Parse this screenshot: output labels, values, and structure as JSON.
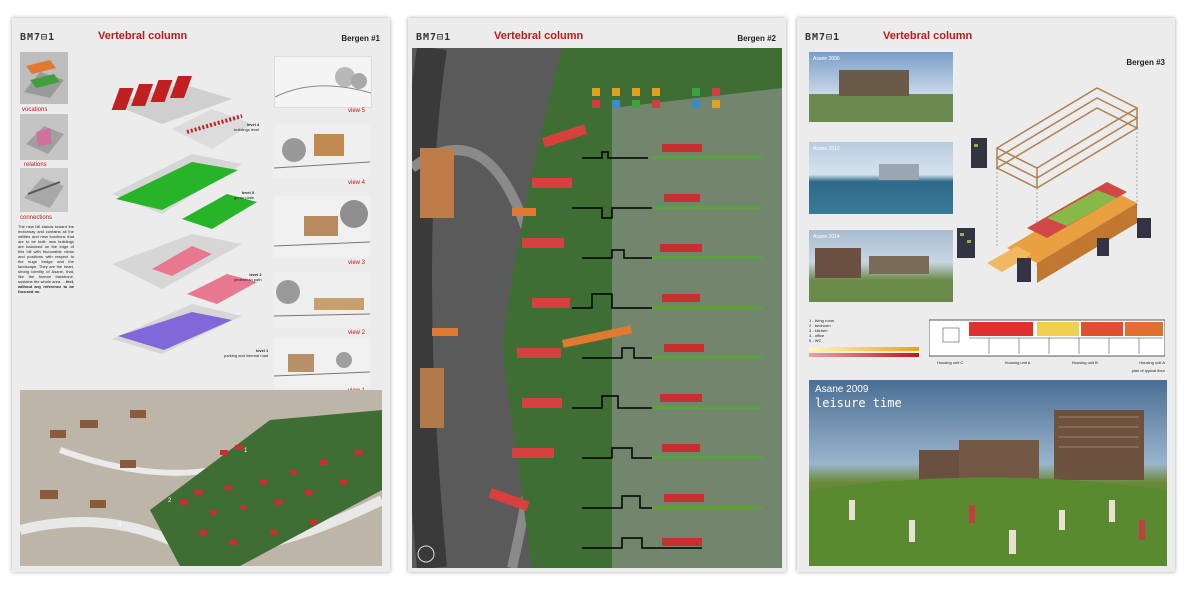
{
  "panels": [
    {
      "logo": "BM7⊟1",
      "title": "Vertebral column",
      "sheet": "Bergen #1",
      "sidebar_labels": [
        "vocations",
        "relations",
        "connections"
      ],
      "levels": [
        {
          "name": "level 4",
          "desc": "buildings level"
        },
        {
          "name": "level 3",
          "desc": "green plate"
        },
        {
          "name": "level 2",
          "desc": "pedestrian path"
        },
        {
          "name": "level 1",
          "desc": "parking and internal road"
        }
      ],
      "views": [
        "view 5",
        "view 4",
        "view 3",
        "view 2",
        "view 1"
      ],
      "body_text": "The new hill stands toward the motorway and contains all the utilities and new functions that are to be built: new buildings are balanced on the edge of this hill with favourable views and positions with respect to the huge bridge and the landscape. They are the heart, strong identity of Asane, that, like the human backbone, sustains the whole area ...",
      "emphasis_text": "feel, without any reference to be focused on.",
      "map_labels": [
        "1",
        "2",
        "3"
      ]
    },
    {
      "logo": "BM7⊟1",
      "title": "Vertebral column",
      "sheet": "Bergen #2"
    },
    {
      "logo": "BM7⊟1",
      "title": "Vertebral column",
      "sheet": "Bergen #3",
      "photos": [
        {
          "caption": "Asane 2006"
        },
        {
          "caption": "Asane 2012"
        },
        {
          "caption": "Asane 2014"
        }
      ],
      "legend": [
        "1 - living room",
        "2 - bedroom",
        "3 - kitchen",
        "4 - office",
        "5 - WC"
      ],
      "plan_label": "plan of typical floor",
      "housing_units": [
        "Housing unit C",
        "Housing unit A",
        "Housing unit B",
        "Housing unit A"
      ],
      "hero_year": "Asane 2009",
      "hero_title": "leisure time"
    }
  ],
  "colors": {
    "accent_red": "#c01818",
    "green_level": "#28b428",
    "pink_level": "#e87890",
    "purple_level": "#8068d8",
    "roof_red": "#c83030",
    "map_green": "#3e6e34"
  }
}
